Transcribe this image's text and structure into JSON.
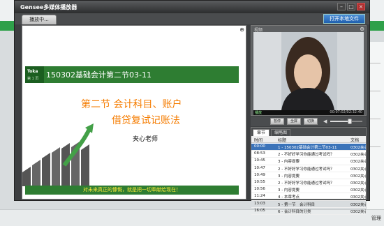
{
  "app": {
    "title": "Gensee多媒体播放器",
    "playing_tab": "播放中...",
    "open_file_button": "打开本地文件"
  },
  "background": {
    "bottom_right_text": "管理"
  },
  "slide": {
    "logo": "Toka",
    "header_title": "150302基础会计第二节03-11",
    "header_page": "第 1 页",
    "main_title": "第二节 会计科目、账户",
    "sub_title": "借贷复试记账法",
    "teacher": "夹心老师",
    "motto": "对未来真正的慷慨，就是把一切奉献给现在！"
  },
  "video": {
    "label": "视频",
    "status_left": "播放",
    "time": "00:07:02/02:32:40",
    "buttons": {
      "pause": "暂停",
      "fullscreen": "全屏",
      "switch": "切换"
    },
    "volume": 0.6
  },
  "chapters": {
    "tabs": [
      "章节",
      "编略图"
    ],
    "headers": {
      "time": "时间",
      "title": "标题",
      "doc": "文档"
    },
    "rows": [
      {
        "time": "00:00",
        "title": "1 - 150302基础会计第二节03-11",
        "doc": "0302夹心"
      },
      {
        "time": "08:53",
        "title": "2 - 不好好学习你能通过考试吗？",
        "doc": "0302夹心"
      },
      {
        "time": "10:45",
        "title": "3 - 内容提要",
        "doc": "0302夹心"
      },
      {
        "time": "10:47",
        "title": "2 - 不好好学习你能通过考试吗？",
        "doc": "0302夹心"
      },
      {
        "time": "10:49",
        "title": "3 - 内容提要",
        "doc": "0302夹心"
      },
      {
        "time": "10:55",
        "title": "2 - 不好好学习你能通过考试吗？",
        "doc": "0302夹心"
      },
      {
        "time": "10:56",
        "title": "3 - 内容提要",
        "doc": "0302夹心"
      },
      {
        "time": "11:24",
        "title": "4 - 本章考点",
        "doc": "0302夹心"
      },
      {
        "time": "13:03",
        "title": "5 - 第一节　会计科目",
        "doc": "0302夹心"
      },
      {
        "time": "16:05",
        "title": "6 - 会计科目的分类",
        "doc": "0302夹心"
      }
    ]
  }
}
